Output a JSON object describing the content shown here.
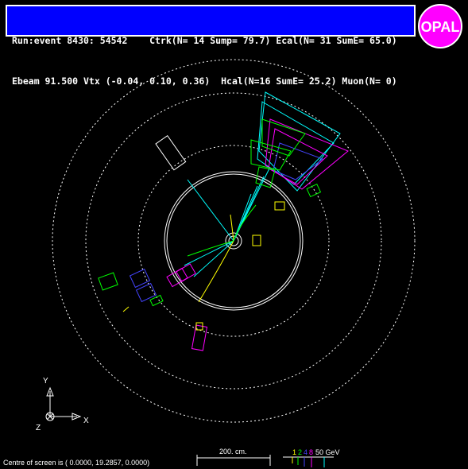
{
  "header": {
    "line1": "Run:event 8430: 54542    Ctrk(N= 14 Sump= 79.7) Ecal(N= 31 SumE= 65.0)",
    "line2": "Ebeam 91.500 Vtx (-0.04, 0.10, 0.36)  Hcal(N=16 SumE= 25.2) Muon(N= 0)"
  },
  "logo": {
    "text": "OPAL",
    "fill": "#ff00ff",
    "ring": "#ffffff"
  },
  "axes": {
    "y_label": "Y",
    "x_label": "X",
    "z_label": "Z"
  },
  "scale_bar": {
    "label": "200. cm."
  },
  "energy_scale": {
    "labels": [
      "1",
      "2",
      "4",
      "8",
      "50 GeV"
    ],
    "colors": [
      "#ffff00",
      "#00ff00",
      "#4444ff",
      "#ff00ff",
      "#00ffff"
    ]
  },
  "footer": {
    "centre_text": "Centre of screen is (   0.0000,   19.2857,    0.0000)"
  },
  "colors": {
    "background": "#000000",
    "header_bg": "#0000ff",
    "track": "#00ffff",
    "ecal": "#00ff00",
    "hcal": "#ff00ff",
    "lowE": "#ffff00",
    "detector": "#ffffff"
  }
}
